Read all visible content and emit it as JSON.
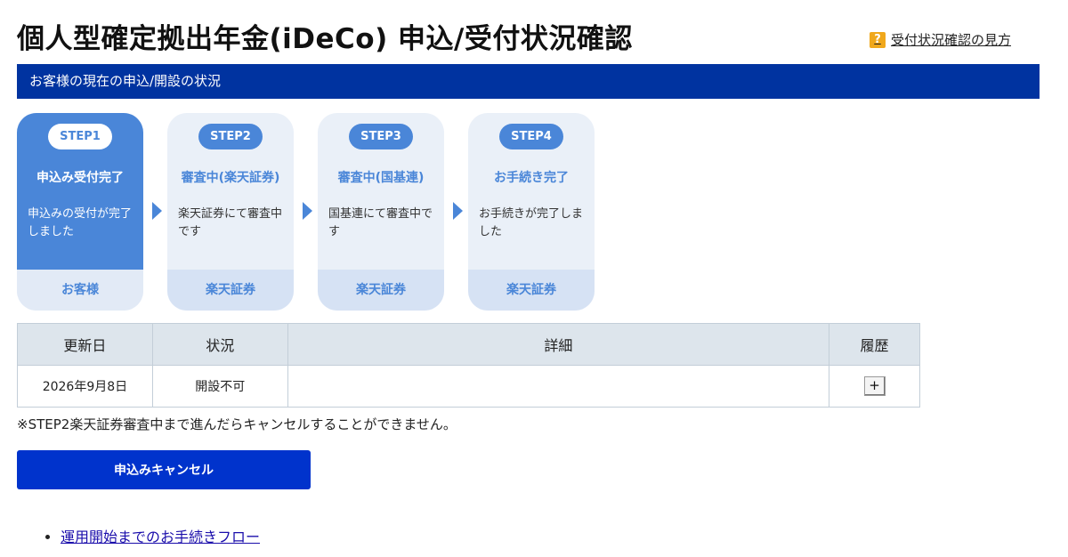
{
  "header": {
    "title": "個人型確定拠出年金(iDeCo) 申込/受付状況確認",
    "help_icon": "?",
    "help_link": "受付状況確認の見方"
  },
  "section": {
    "title": "お客様の現在の申込/開設の状況"
  },
  "steps": [
    {
      "label": "STEP1",
      "title": "申込み受付完了",
      "desc": "申込みの受付が完了しました",
      "owner": "お客様",
      "active": true
    },
    {
      "label": "STEP2",
      "title": "審査中(楽天証券)",
      "desc": "楽天証券にて審査中です",
      "owner": "楽天証券",
      "active": false
    },
    {
      "label": "STEP3",
      "title": "審査中(国基連)",
      "desc": "国基連にて審査中です",
      "owner": "楽天証券",
      "active": false
    },
    {
      "label": "STEP4",
      "title": "お手続き完了",
      "desc": "お手続きが完了しました",
      "owner": "楽天証券",
      "active": false
    }
  ],
  "table": {
    "headers": [
      "更新日",
      "状況",
      "詳細",
      "履歴"
    ],
    "rows": [
      {
        "date": "2026年9月8日",
        "status": "開設不可",
        "detail": "",
        "expand": "+"
      }
    ]
  },
  "note": "※STEP2楽天証券審査中まで進んだらキャンセルすることができません。",
  "cancel_button": "申込みキャンセル",
  "links": [
    "運用開始までのお手続きフロー"
  ],
  "colors": {
    "navy": "#0033a0",
    "step_blue": "#4a86d8",
    "button_blue": "#0033cc",
    "help_icon": "#f0a81c"
  }
}
